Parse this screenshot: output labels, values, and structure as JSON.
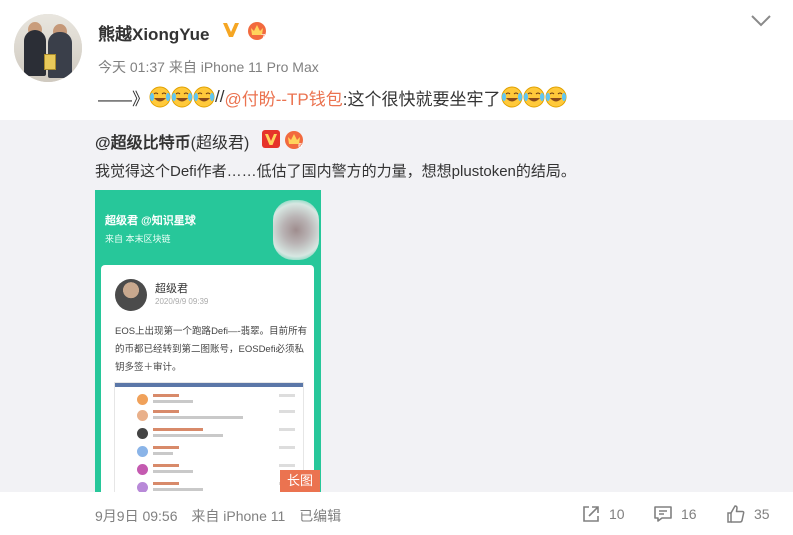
{
  "post": {
    "author_name": "熊越XiongYue",
    "meta": "今天 01:37 来自 iPhone 11 Pro Max",
    "content_prefix": "——》",
    "content_sep": "//",
    "content_mention": "@付盼--TP钱包",
    "content_suffix": ":这个很快就要坐牢了"
  },
  "repost": {
    "user": "@超级比特币",
    "nick": "(超级君)",
    "text": "我觉得这个Defi作者……低估了国内警方的力量，想想plustoken的结局。",
    "image": {
      "header_title": "超级君 @知识星球",
      "header_sub": "来自 本末区块链",
      "card_name": "超级君",
      "card_date": "2020/9/9 09:39",
      "card_body": "EOS上出现第一个跑路Defi—-翡翠。目前所有的币都已经转到第二图账号，EOSDefi必须私钥多签＋审计。",
      "long_tag": "长图"
    }
  },
  "footer": {
    "time": "9月9日 09:56",
    "source": "来自 iPhone 11",
    "edited": "已编辑",
    "share_count": "10",
    "comment_count": "16",
    "like_count": "35"
  },
  "colors": {
    "accent_orange": "#eb7350",
    "repost_bg": "#f2f2f5",
    "image_green": "#27c79a"
  }
}
